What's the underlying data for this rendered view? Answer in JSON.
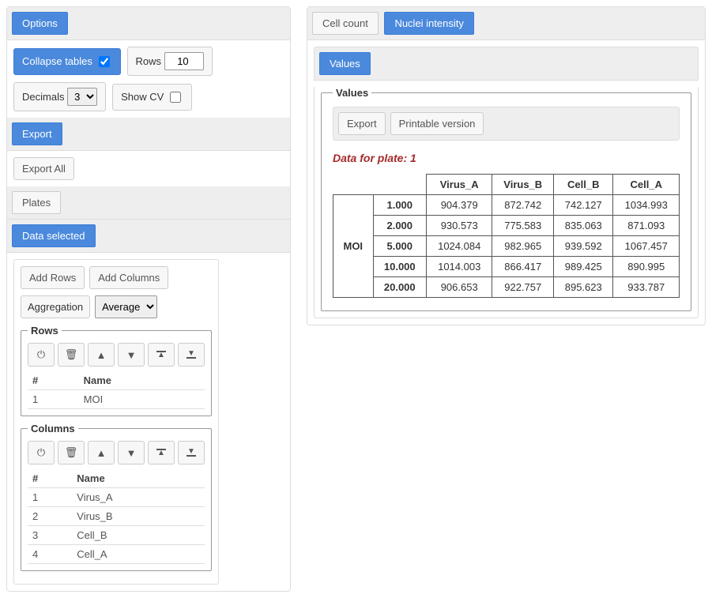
{
  "left": {
    "options_label": "Options",
    "collapse_tables_label": "Collapse tables",
    "collapse_tables_checked": true,
    "rows_label": "Rows",
    "rows_value": 10,
    "decimals_label": "Decimals",
    "decimals_value": "3",
    "show_cv_label": "Show CV",
    "show_cv_checked": false,
    "export_label": "Export",
    "export_all_label": "Export All",
    "plates_label": "Plates",
    "data_selected_label": "Data selected",
    "add_rows_label": "Add Rows",
    "add_columns_label": "Add Columns",
    "aggregation_label": "Aggregation",
    "aggregation_value": "Average",
    "rows_fieldset": "Rows",
    "columns_fieldset": "Columns",
    "hash_header": "#",
    "name_header": "Name",
    "rows_list": [
      {
        "index": "1",
        "name": "MOI"
      }
    ],
    "cols_list": [
      {
        "index": "1",
        "name": "Virus_A"
      },
      {
        "index": "2",
        "name": "Virus_B"
      },
      {
        "index": "3",
        "name": "Cell_B"
      },
      {
        "index": "4",
        "name": "Cell_A"
      }
    ]
  },
  "right": {
    "tab_cell_count": "Cell count",
    "tab_nuclei_intensity": "Nuclei intensity",
    "values_label": "Values",
    "values_legend": "Values",
    "export_label": "Export",
    "printable_label": "Printable version",
    "plate_title": "Data for plate: 1",
    "row_group": "MOI",
    "columns": [
      "Virus_A",
      "Virus_B",
      "Cell_B",
      "Cell_A"
    ],
    "rows": [
      {
        "h": "1.000",
        "v": [
          "904.379",
          "872.742",
          "742.127",
          "1034.993"
        ]
      },
      {
        "h": "2.000",
        "v": [
          "930.573",
          "775.583",
          "835.063",
          "871.093"
        ]
      },
      {
        "h": "5.000",
        "v": [
          "1024.084",
          "982.965",
          "939.592",
          "1067.457"
        ]
      },
      {
        "h": "10.000",
        "v": [
          "1014.003",
          "866.417",
          "989.425",
          "890.995"
        ]
      },
      {
        "h": "20.000",
        "v": [
          "906.653",
          "922.757",
          "895.623",
          "933.787"
        ]
      }
    ]
  }
}
